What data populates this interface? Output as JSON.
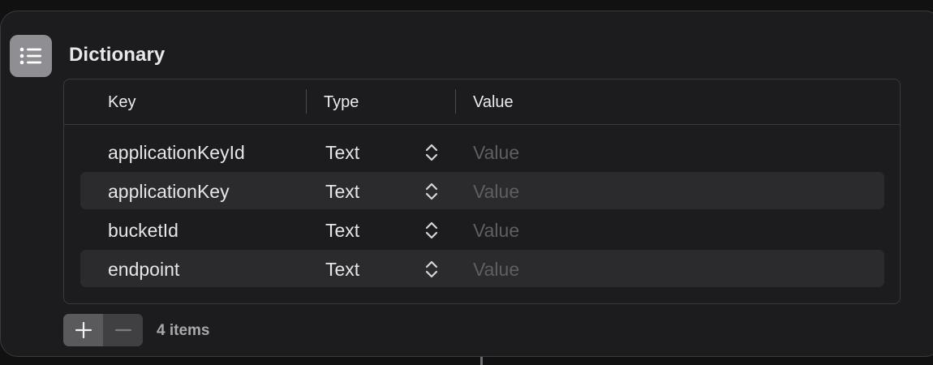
{
  "action": {
    "title": "Dictionary",
    "icon": "list-icon"
  },
  "table": {
    "columns": {
      "key": "Key",
      "type": "Type",
      "value": "Value"
    },
    "rows": [
      {
        "key": "applicationKeyId",
        "type": "Text",
        "value_placeholder": "Value"
      },
      {
        "key": "applicationKey",
        "type": "Text",
        "value_placeholder": "Value"
      },
      {
        "key": "bucketId",
        "type": "Text",
        "value_placeholder": "Value"
      },
      {
        "key": "endpoint",
        "type": "Text",
        "value_placeholder": "Value"
      }
    ]
  },
  "footer": {
    "add_icon": "plus-icon",
    "remove_icon": "minus-icon",
    "count_label": "4 items"
  },
  "colors": {
    "card_background": "#1c1c1e",
    "icon_background": "#8e8e93",
    "placeholder_text": "#5f5f62"
  }
}
